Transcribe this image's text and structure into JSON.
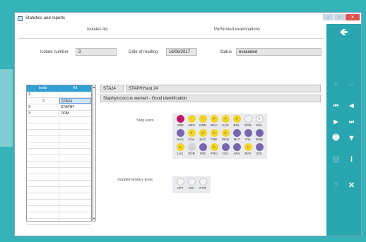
{
  "window": {
    "title": "Statistics and reports",
    "controls": [
      "–",
      "▫",
      "✕"
    ]
  },
  "header": {
    "isolates_tab": "Isolates list",
    "exams_tab": "Performed examinations",
    "isolate_number_label": "Isolate number",
    "isolate_number_value": "3",
    "date_label": "Date of reading",
    "date_value": "16/06/2017",
    "status_label": "Status",
    "status_value": "evaluated"
  },
  "grid": {
    "columns": [
      "Isolat",
      "Kit"
    ],
    "rows": [
      {
        "isolat": "3",
        "kit": ""
      },
      {
        "isolat": "3",
        "kit": "STA24"
      },
      {
        "isolat": "3",
        "kit": "STAPHY"
      },
      {
        "isolat": "3",
        "kit": "ODM"
      }
    ],
    "empty_rows": 17
  },
  "detail": {
    "kit_code": "STA24",
    "kit_name": "STAPHYtest 24",
    "identification": "Staphylococcus warneri - Good identification",
    "strip_label": "Strip tests",
    "supp_label": "Supplementary tests"
  },
  "strip_tests": [
    [
      {
        "label": "URE",
        "color": "#c4186b",
        "mark": "+"
      },
      {
        "label": "ARG",
        "color": "#f2d424",
        "mark": "-"
      },
      {
        "label": "ORN",
        "color": "#f2d424",
        "mark": "-"
      },
      {
        "label": "BGA",
        "color": "#f2d424",
        "mark": "+"
      },
      {
        "label": "GLR",
        "color": "#f2d424",
        "mark": "+"
      },
      {
        "label": "BGL",
        "color": "#f2d424",
        "mark": "+"
      },
      {
        "label": "PHS",
        "color": "#f4f4f4",
        "mark": "-"
      },
      {
        "label": "ESL",
        "color": "#f4f4f4",
        "mark": "+"
      }
    ],
    [
      {
        "label": "NAG",
        "color": "#7a66b0",
        "mark": "-"
      },
      {
        "label": "GAL",
        "color": "#f2d424",
        "mark": "+"
      },
      {
        "label": "SUC",
        "color": "#f2d424",
        "mark": "+"
      },
      {
        "label": "TRE",
        "color": "#f2d424",
        "mark": "+"
      },
      {
        "label": "MAN",
        "color": "#f2d424",
        "mark": "+"
      },
      {
        "label": "MLT",
        "color": "#7a66b0",
        "mark": "-"
      },
      {
        "label": "XYL",
        "color": "#7a66b0",
        "mark": "-"
      },
      {
        "label": "MNE",
        "color": "#7a66b0",
        "mark": "-"
      }
    ],
    [
      {
        "label": "LAC",
        "color": "#f2d424",
        "mark": "+"
      },
      {
        "label": "SOR",
        "color": "#d4d4d4",
        "mark": ""
      },
      {
        "label": "RIB",
        "color": "#7a66b0",
        "mark": "-"
      },
      {
        "label": "FRU",
        "color": "#f2d424",
        "mark": "+"
      },
      {
        "label": "CEL",
        "color": "#7a66b0",
        "mark": "-"
      },
      {
        "label": "ARA",
        "color": "#7a66b0",
        "mark": "-"
      },
      {
        "label": "RAF",
        "color": "#f2d424",
        "mark": "+"
      },
      {
        "label": "XOL",
        "color": "#7a66b0",
        "mark": "-"
      }
    ]
  ],
  "supp_tests": [
    {
      "label": "VPT",
      "color": "#f4f4f4",
      "mark": ""
    },
    {
      "label": "OXI",
      "color": "#f4f4f4",
      "mark": ""
    },
    {
      "label": "PYR",
      "color": "#f4f4f4",
      "mark": ""
    }
  ],
  "sidebar": {
    "back": "🡸",
    "plus": "+",
    "minus": "–",
    "first": "⏮",
    "prev": "◀",
    "next": "▶",
    "last": "⏭",
    "print": "🖶",
    "filter": "▼",
    "report": "▤",
    "info": "i",
    "help": "?",
    "close": "✕"
  },
  "colors": {
    "accent": "#29a5af",
    "background": "#35b3b9",
    "grid_header": "#2f9fd4"
  }
}
